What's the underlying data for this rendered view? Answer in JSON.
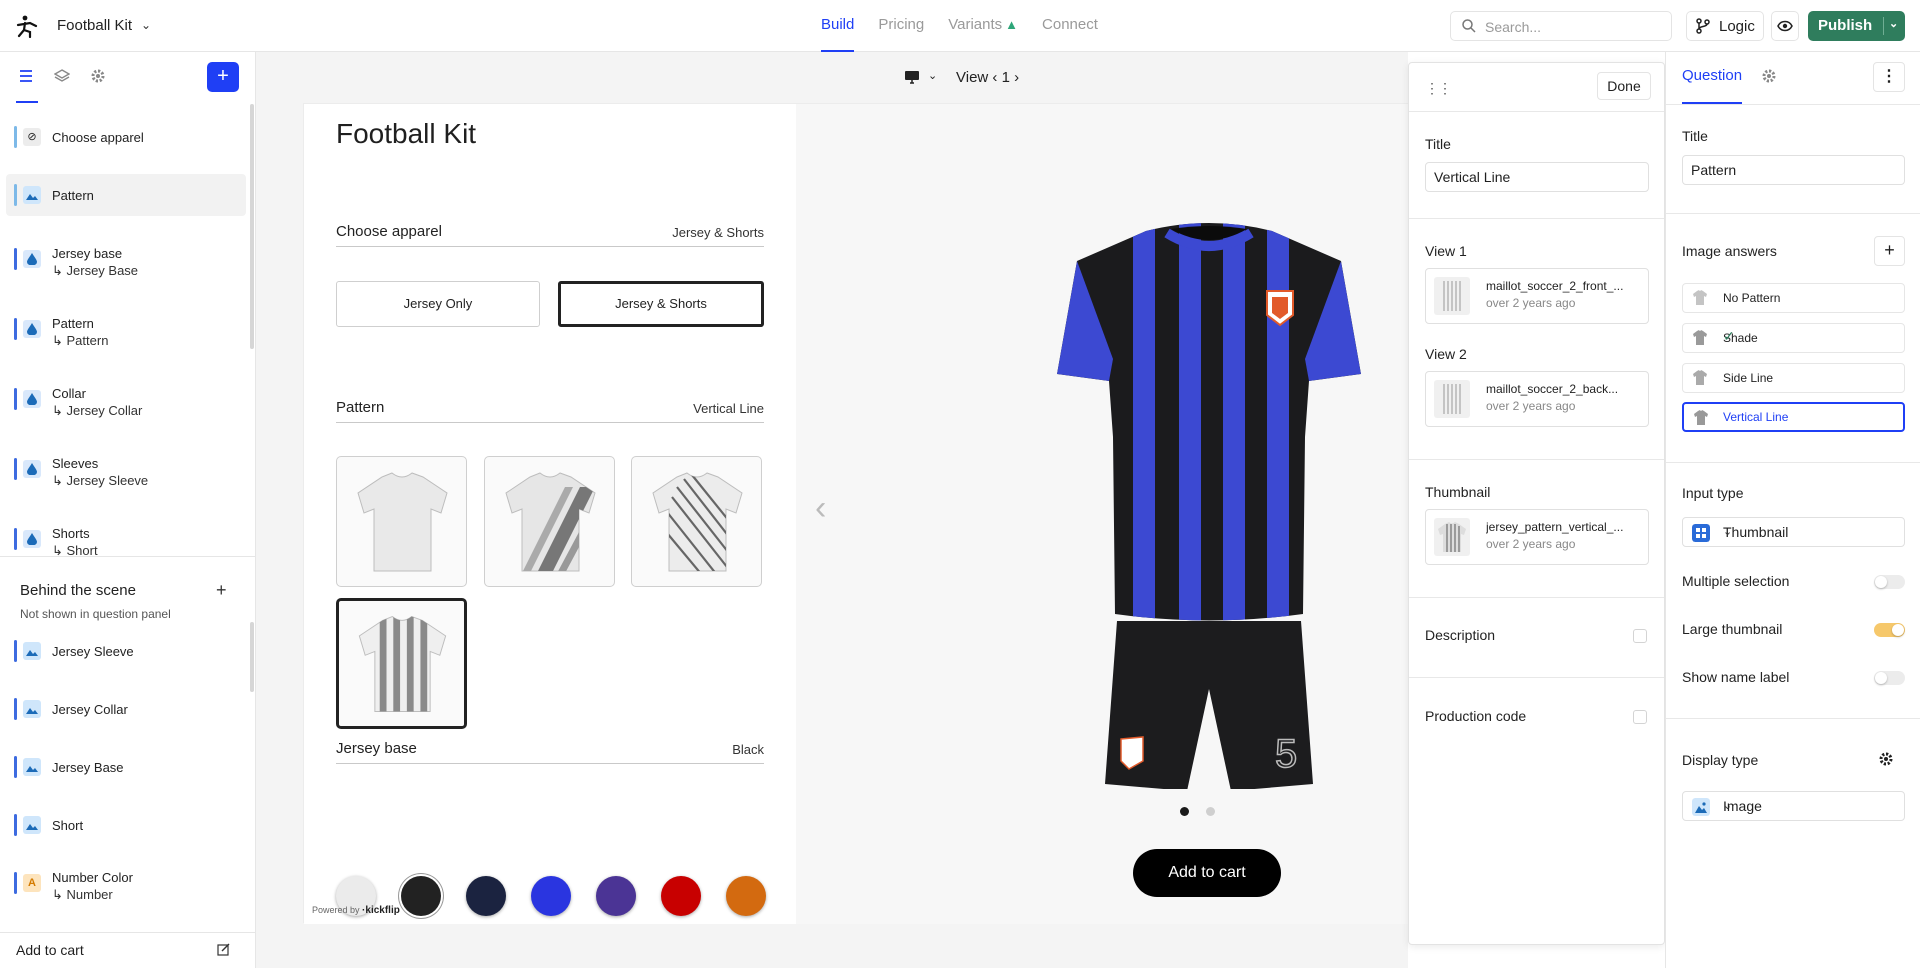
{
  "app": {
    "project_name": "Football Kit",
    "nav_tabs": [
      "Build",
      "Pricing",
      "Variants",
      "Connect"
    ],
    "search_placeholder": "Search...",
    "logic_label": "Logic",
    "publish_label": "Publish"
  },
  "left_panel": {
    "questions": [
      {
        "name": "Choose apparel",
        "sub": "",
        "icon": "slash-circle-icon"
      },
      {
        "name": "Pattern",
        "sub": "",
        "icon": "image-icon"
      },
      {
        "name": "Jersey base",
        "sub": "↳ Jersey Base",
        "icon": "drop-icon"
      },
      {
        "name": "Pattern",
        "sub": "↳ Pattern",
        "icon": "drop-icon"
      },
      {
        "name": "Collar",
        "sub": "↳ Jersey Collar",
        "icon": "drop-icon"
      },
      {
        "name": "Sleeves",
        "sub": "↳ Jersey Sleeve",
        "icon": "drop-icon"
      },
      {
        "name": "Shorts",
        "sub": "↳ Short",
        "icon": "drop-icon"
      }
    ],
    "behind_title": "Behind the scene",
    "behind_sub": "Not shown in question panel",
    "behind_items": [
      {
        "name": "Jersey Sleeve",
        "sub": ""
      },
      {
        "name": "Jersey Collar",
        "sub": ""
      },
      {
        "name": "Jersey Base",
        "sub": ""
      },
      {
        "name": "Short",
        "sub": ""
      },
      {
        "name": "Number Color",
        "sub": "↳ Number"
      }
    ],
    "footer": "Add to cart"
  },
  "canvas": {
    "view_label": "View ‹ 1 ›",
    "title": "Football Kit",
    "sections": [
      {
        "label": "Choose apparel",
        "value": "Jersey & Shorts"
      },
      {
        "label": "Pattern",
        "value": "Vertical Line"
      },
      {
        "label": "Jersey base",
        "value": "Black"
      }
    ],
    "apparel_options": [
      "Jersey Only",
      "Jersey & Shorts"
    ],
    "swatch_colors": [
      "#ebebeb",
      "#222222",
      "#1b2340",
      "#2a35e0",
      "#4b3495",
      "#c80000",
      "#d36a10"
    ],
    "add_to_cart": "Add to cart",
    "powered_by": "Powered by",
    "powered_brand": "·kickflip"
  },
  "answer_panel": {
    "done": "Done",
    "title_label": "Title",
    "title_value": "Vertical Line",
    "view1_label": "View 1",
    "view1_file": "maillot_soccer_2_front_...",
    "view1_date": "over 2 years ago",
    "view2_label": "View 2",
    "view2_file": "maillot_soccer_2_back...",
    "view2_date": "over 2 years ago",
    "thumb_label": "Thumbnail",
    "thumb_file": "jersey_pattern_vertical_...",
    "thumb_date": "over 2 years ago",
    "description_label": "Description",
    "production_label": "Production code"
  },
  "right_panel": {
    "tab": "Question",
    "title_label": "Title",
    "title_value": "Pattern",
    "image_answers_label": "Image answers",
    "answers": [
      "No Pattern",
      "Shade",
      "Side Line",
      "Vertical Line"
    ],
    "input_type_label": "Input type",
    "input_type_value": "Thumbnail",
    "multiple_selection": "Multiple selection",
    "large_thumbnail": "Large thumbnail",
    "show_name_label": "Show name label",
    "display_type_label": "Display type",
    "display_type_value": "Image"
  }
}
